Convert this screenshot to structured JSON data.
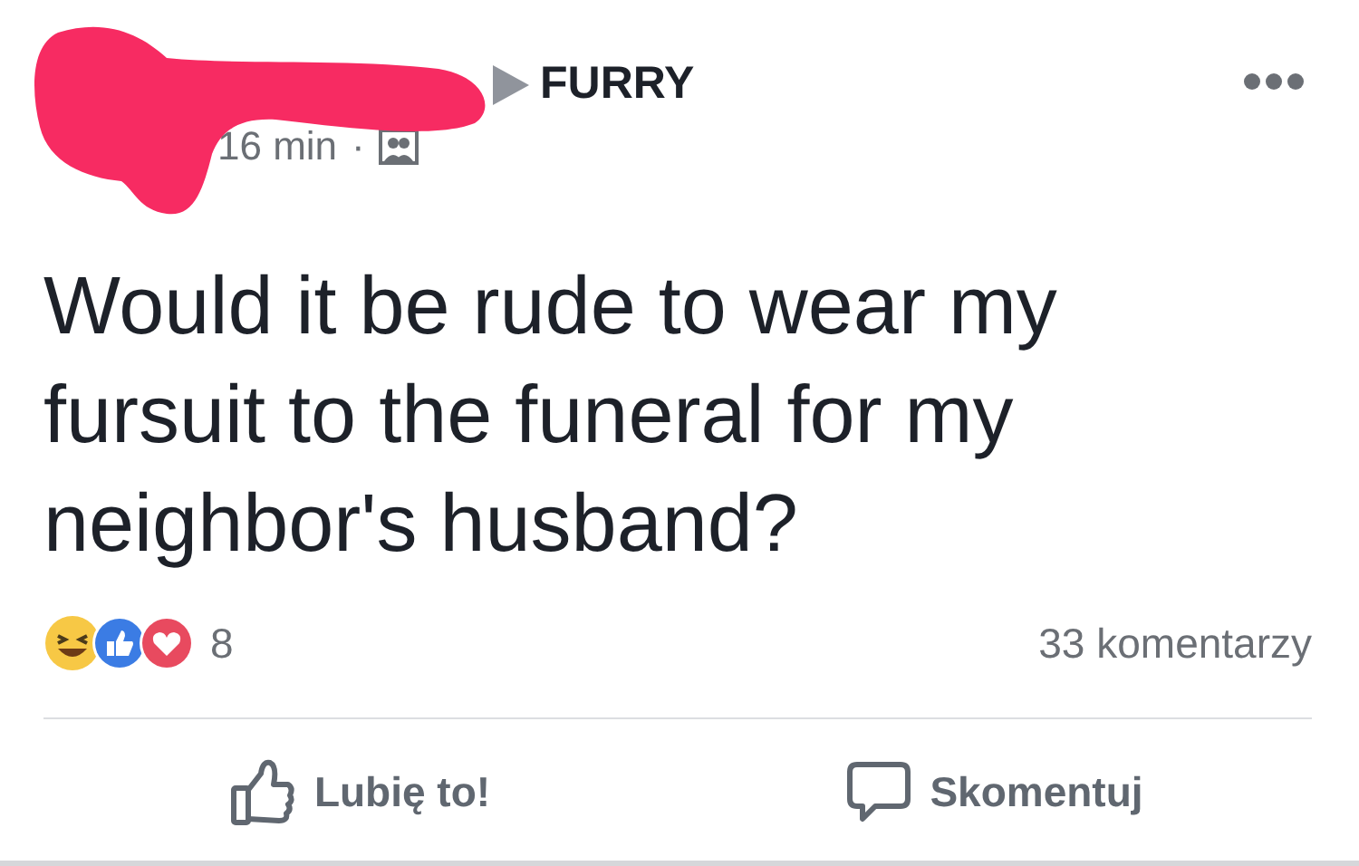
{
  "post": {
    "group": "FURRY",
    "time": "16 min",
    "separator": "·",
    "text_lines": [
      "Would it be rude to wear my",
      "fursuit to the funeral for my",
      "neighbor's husband?"
    ],
    "reactions_count": "8",
    "comments": "33 komentarzy",
    "actions": [
      {
        "kind": "like",
        "label": "Lubię to!"
      },
      {
        "kind": "comment",
        "label": "Skomentuj"
      }
    ]
  }
}
